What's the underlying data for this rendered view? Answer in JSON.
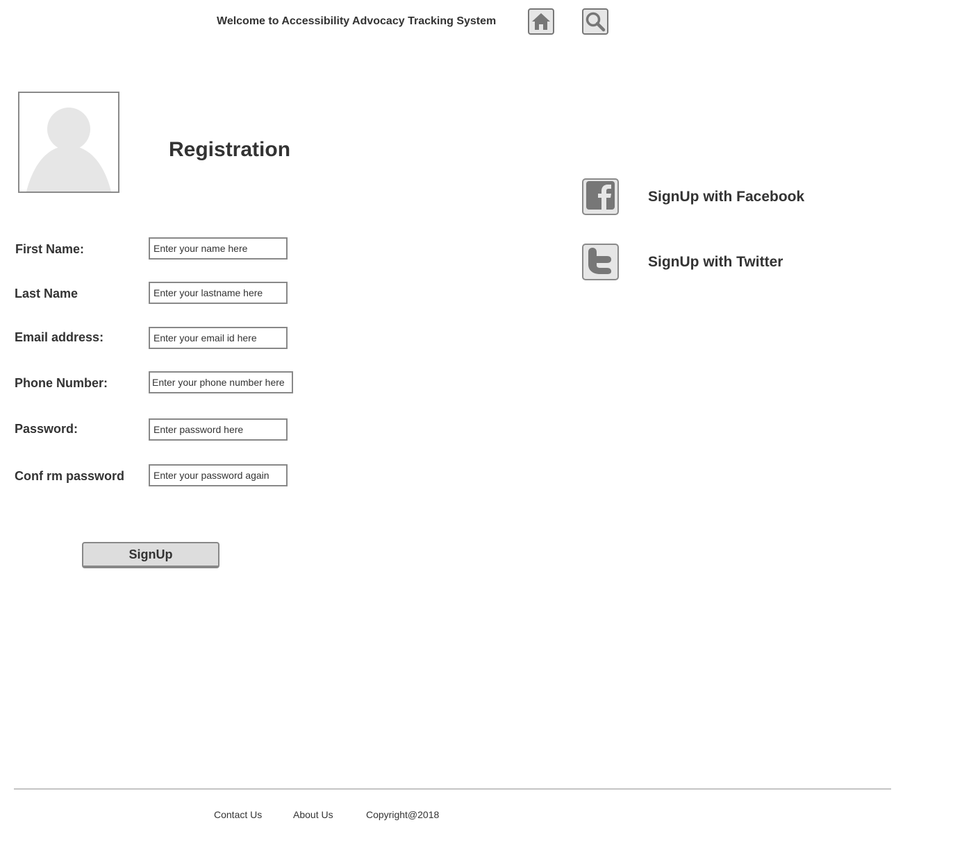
{
  "header": {
    "welcome": "Welcome to Accessibility Advocacy Tracking System",
    "home_icon": "home-icon",
    "search_icon": "search-icon"
  },
  "avatar": {
    "icon": "user-avatar-placeholder"
  },
  "title": "Registration",
  "form": {
    "fields": [
      {
        "label": "First Name:",
        "placeholder": "Enter your name here"
      },
      {
        "label": "Last Name",
        "placeholder": "Enter your lastname here"
      },
      {
        "label": "Email address:",
        "placeholder": "Enter your email id here"
      },
      {
        "label": "Phone Number:",
        "placeholder": "Enter your phone number here"
      },
      {
        "label": "Password:",
        "placeholder": "Enter password here"
      },
      {
        "label": "Conf rm password",
        "placeholder": "Enter your password again"
      }
    ],
    "submit_label": "SignUp"
  },
  "social": {
    "facebook_label": "SignUp with Facebook",
    "twitter_label": "SignUp with Twitter",
    "facebook_icon": "facebook-icon",
    "twitter_icon": "twitter-icon"
  },
  "footer": {
    "links": [
      "Contact Us",
      "About Us",
      "Copyright@2018"
    ]
  },
  "colors": {
    "text": "#333333",
    "border": "#888888",
    "icon_fill": "#777777",
    "button_bg": "#dddddd",
    "icon_bg": "#e6e6e6"
  }
}
